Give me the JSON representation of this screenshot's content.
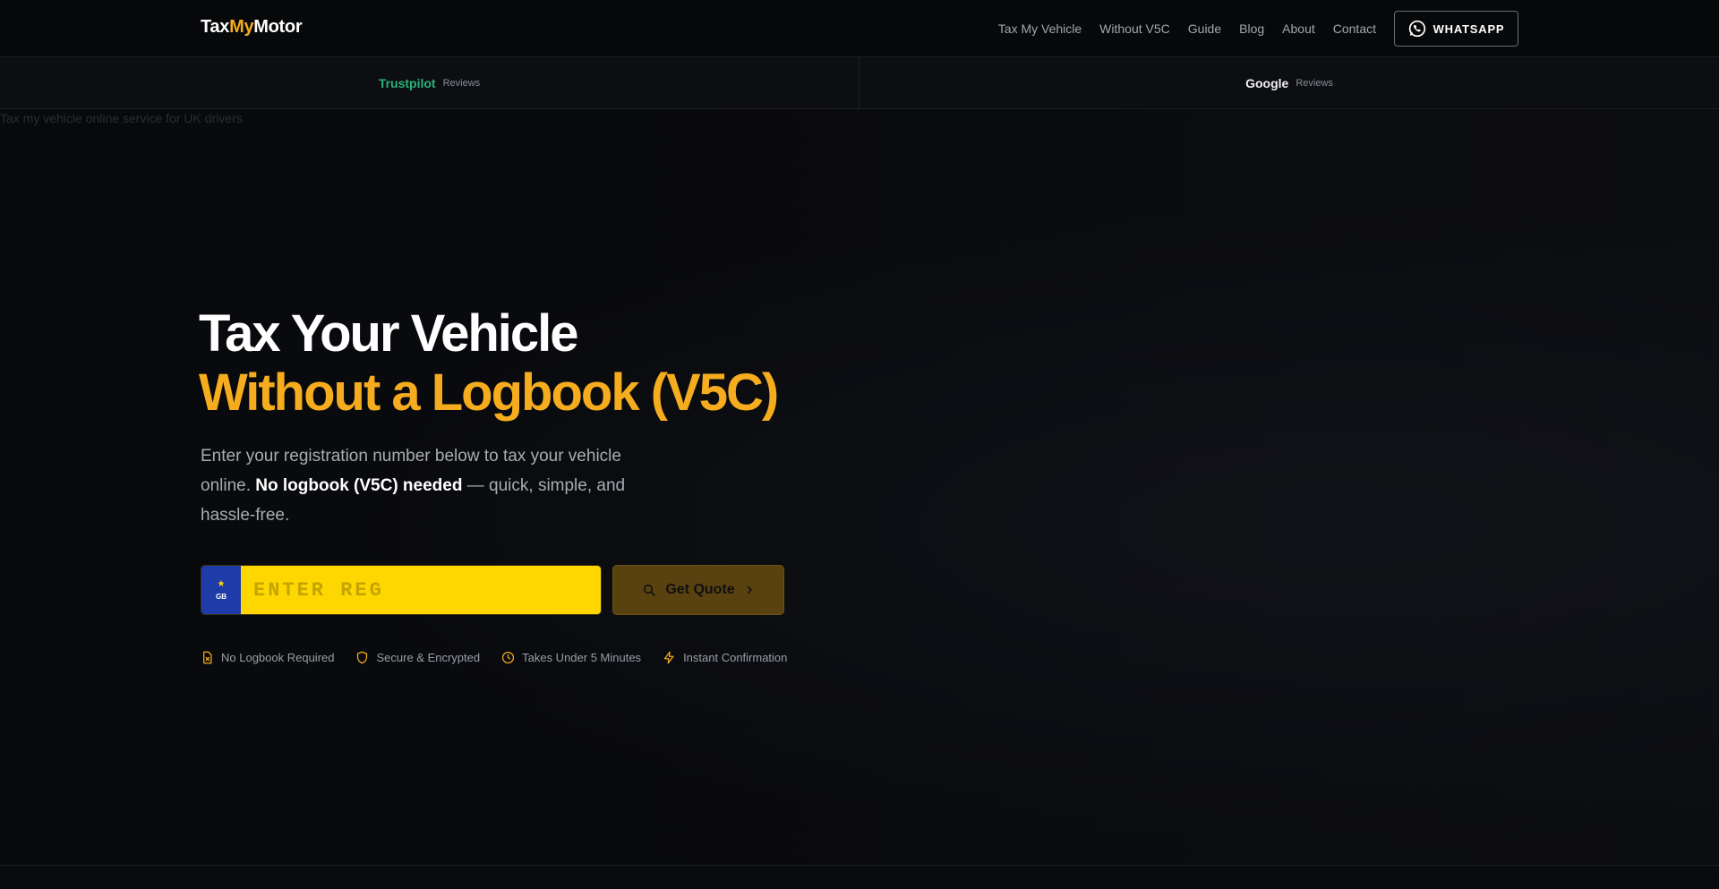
{
  "brand": {
    "part1": "Tax",
    "part2": "My",
    "part3": "Motor"
  },
  "nav": {
    "links": [
      "Tax My Vehicle",
      "Without V5C",
      "Guide",
      "Blog",
      "About",
      "Contact"
    ],
    "whatsapp_label": "WHATSAPP"
  },
  "reviews": [
    {
      "name": "Trustpilot",
      "label": "Reviews"
    },
    {
      "name": "Google",
      "label": "Reviews"
    }
  ],
  "hero": {
    "image_alt": "Tax my vehicle online service for UK drivers",
    "title_line1": "Tax Your Vehicle",
    "title_line2": "Without a Logbook (V5C)",
    "subtitle_pre": "Enter your registration number below to tax your vehicle online.",
    "subtitle_bold": "No logbook (V5C) needed",
    "subtitle_post": "— quick, simple, and hassle-free.",
    "reg_placeholder": "ENTER REG",
    "reg_value": "",
    "plate_country": "GB",
    "quote_label": "Get Quote"
  },
  "features": [
    {
      "icon": "document-x-icon",
      "label": "No Logbook Required"
    },
    {
      "icon": "shield-icon",
      "label": "Secure & Encrypted"
    },
    {
      "icon": "clock-icon",
      "label": "Takes Under 5 Minutes"
    },
    {
      "icon": "lightning-icon",
      "label": "Instant Confirmation"
    }
  ],
  "colors": {
    "accent": "#f5ac1e",
    "plate_yellow": "#ffd700",
    "plate_blue": "#1e3ba8",
    "trustpilot_green": "#28b37a",
    "background": "#08090c"
  }
}
